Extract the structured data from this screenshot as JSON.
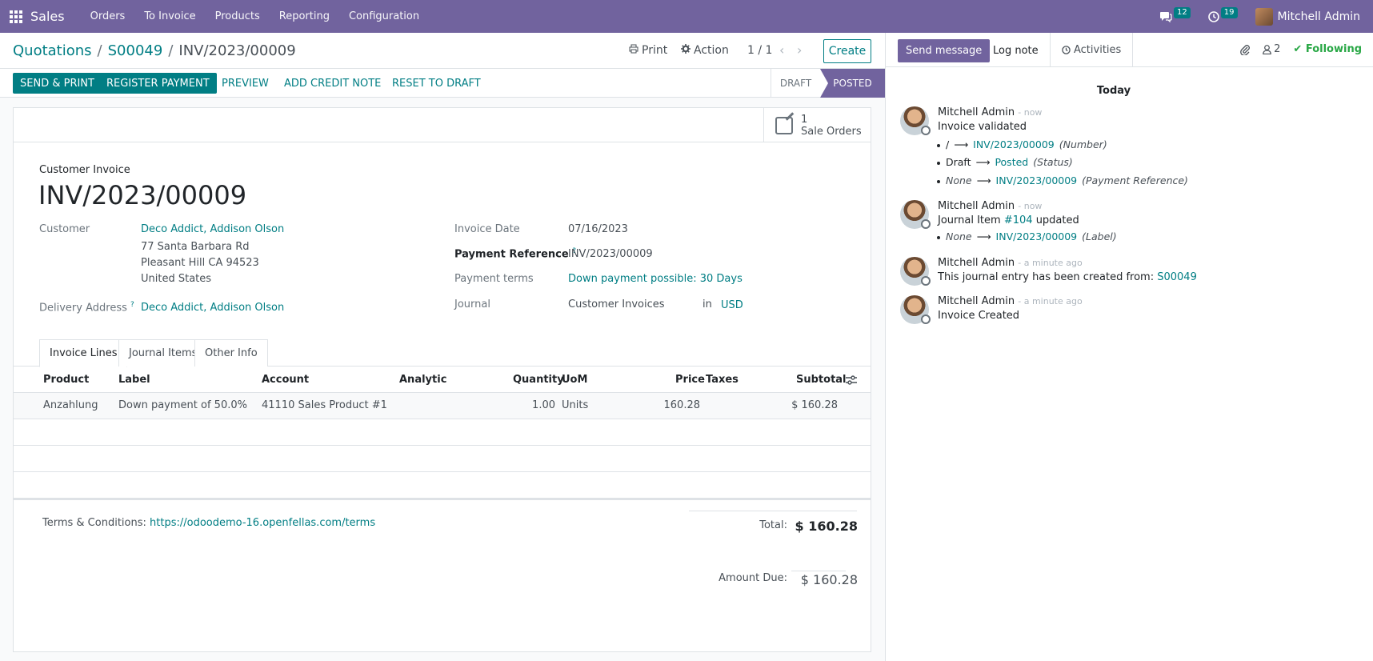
{
  "navbar": {
    "app": "Sales",
    "menu": [
      "Orders",
      "To Invoice",
      "Products",
      "Reporting",
      "Configuration"
    ],
    "messages_count": "12",
    "activities_count": "19",
    "user": "Mitchell Admin"
  },
  "control": {
    "breadcrumb": [
      "Quotations",
      "S00049",
      "INV/2023/00009"
    ],
    "print": "Print",
    "action": "Action",
    "pager": "1 / 1",
    "create": "Create"
  },
  "statusbar": {
    "buttons": [
      "SEND & PRINT",
      "REGISTER PAYMENT",
      "PREVIEW",
      "ADD CREDIT NOTE",
      "RESET TO DRAFT"
    ],
    "stages": [
      "DRAFT",
      "POSTED"
    ]
  },
  "smart": {
    "count": "1",
    "label": "Sale Orders"
  },
  "invoice": {
    "type": "Customer Invoice",
    "name": "INV/2023/00009",
    "customer_label": "Customer",
    "customer": "Deco Addict, Addison Olson",
    "address": [
      "77 Santa Barbara Rd",
      "Pleasant Hill CA 94523",
      "United States"
    ],
    "delivery_label": "Delivery Address",
    "delivery": "Deco Addict, Addison Olson",
    "date_label": "Invoice Date",
    "date": "07/16/2023",
    "payref_label": "Payment Reference",
    "payref": "INV/2023/00009",
    "terms_label": "Payment terms",
    "terms": "Down payment possible: 30 Days",
    "journal_label": "Journal",
    "journal": "Customer Invoices",
    "in": "in",
    "currency": "USD"
  },
  "tabs": [
    "Invoice Lines",
    "Journal Items",
    "Other Info"
  ],
  "lines": {
    "headers": [
      "Product",
      "Label",
      "Account",
      "Analytic",
      "Quantity",
      "UoM",
      "Price",
      "Taxes",
      "Subtotal"
    ],
    "rows": [
      [
        "Anzahlung",
        "Down payment of 50.0%",
        "41110 Sales Product #1",
        "",
        "1.00",
        "Units",
        "160.28",
        "",
        "$ 160.28"
      ]
    ]
  },
  "footer": {
    "terms_label": "Terms & Conditions:",
    "terms_link": "https://odoodemo-16.openfellas.com/terms",
    "total_label": "Total:",
    "total": "$ 160.28",
    "due_label": "Amount Due:",
    "due": "$ 160.28"
  },
  "chatter": {
    "send": "Send message",
    "log": "Log note",
    "activities": "Activities",
    "followers": "2",
    "following": "Following",
    "today": "Today",
    "messages": [
      {
        "author": "Mitchell Admin",
        "when": "- now",
        "body": "Invoice validated",
        "tracking": [
          {
            "old": "/",
            "new": "INV/2023/00009",
            "field": "(Number)"
          },
          {
            "old": "Draft",
            "new": "Posted",
            "field": "(Status)"
          },
          {
            "old": "None",
            "new": "INV/2023/00009",
            "field": "(Payment Reference)"
          }
        ]
      },
      {
        "author": "Mitchell Admin",
        "when": "- now",
        "body_pre": "Journal Item",
        "body_link": "#104",
        "body_post": "updated",
        "tracking": [
          {
            "old": "None",
            "new": "INV/2023/00009",
            "field": "(Label)"
          }
        ]
      },
      {
        "author": "Mitchell Admin",
        "when": "- a minute ago",
        "body_pre": "This journal entry has been created from:",
        "body_link": "S00049"
      },
      {
        "author": "Mitchell Admin",
        "when": "- a minute ago",
        "body": "Invoice Created"
      }
    ]
  },
  "colors": {
    "brand": "#71639e",
    "accent": "#017e84",
    "following": "#28a745"
  }
}
